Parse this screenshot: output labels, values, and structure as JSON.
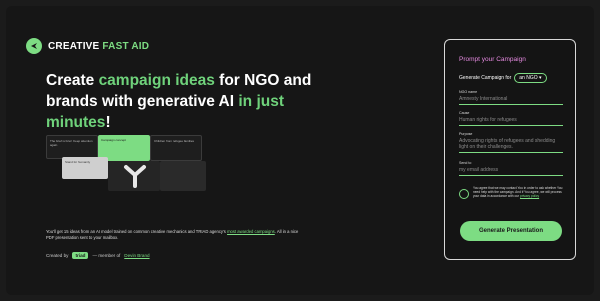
{
  "brand": {
    "name_part1": "CREATIVE ",
    "name_part2": "FAST AID"
  },
  "hero": {
    "line1_a": "Create ",
    "line1_b": "campaign ideas",
    "line1_c": " for NGO and",
    "line2_a": "brands with generative AI ",
    "line2_b": "in just",
    "line3_a": "minutes",
    "line3_b": "!"
  },
  "preview": {
    "card_a": "The brief is brief. Keep attention again",
    "card_b": "Campaign concept",
    "card_c": "Children from refugee families",
    "card_d": "Stand for humanity"
  },
  "description": {
    "p1": "You'll get 15 ideas from an AI model trained on common creative mechanics and TRIAD agency's ",
    "p1_link": "most awarded campaigns",
    "p2": ". All in a nice PDF presentation sent to your mailbox."
  },
  "credit": {
    "created_by": "Created by",
    "chip": "triad",
    "member": "— member of",
    "link": "Devin Brand"
  },
  "form": {
    "title": "Prompt your Campaign",
    "generate_label": "Generate Campaign for",
    "select_value": "an NGO",
    "fields": [
      {
        "label": "NGO name",
        "placeholder": "Amnesty International"
      },
      {
        "label": "Cause",
        "placeholder": "Human rights for refugees"
      },
      {
        "label": "Purpose",
        "placeholder": "Advocating rights of refugees and shedding light on their challenges."
      },
      {
        "label": "Send to",
        "placeholder": "my email address"
      }
    ],
    "consent_text": "You agree that we may contact You in order to ask whether You need help with the campaign. And if You agree, we will process your data in accordance with our ",
    "consent_link": "privacy policy",
    "submit_label": "Generate Presentation"
  },
  "colors": {
    "accent": "#7ddc83",
    "title_pink": "#e58ae0",
    "background": "#161616"
  }
}
